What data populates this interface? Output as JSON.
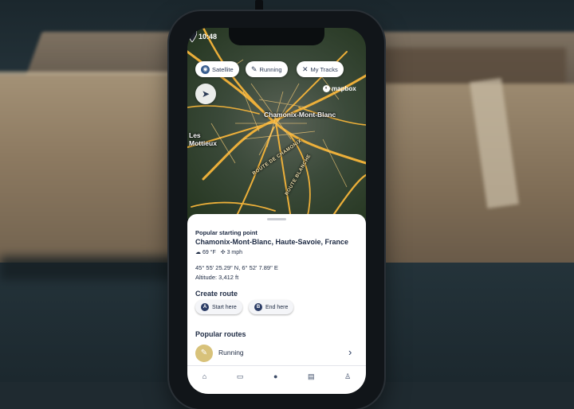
{
  "status": {
    "time": "10:48"
  },
  "map": {
    "chips": [
      {
        "label": "Satellite",
        "icon": "satellite-globe-icon"
      },
      {
        "label": "Running",
        "icon": "running-shoe-icon"
      },
      {
        "label": "My Tracks",
        "icon": "crossed-tracks-icon"
      }
    ],
    "locate_icon": "navigation-arrow-icon",
    "attribution": "mapbox",
    "labels": {
      "town": "Chamonix-Mont-Blanc",
      "village": "Les Mottieux"
    },
    "road_labels": [
      "ROUTE DE CHAMONIX",
      "ROUTE BLANCHE"
    ]
  },
  "sheet": {
    "eyebrow": "Popular starting point",
    "place": "Chamonix-Mont-Blanc, Haute-Savoie, France",
    "weather": {
      "temperature": "69 °F",
      "wind": "3 mph"
    },
    "coordinates": "45° 55' 25.29\" N, 6° 52' 7.89\" E",
    "altitude": "Altitude: 3,412 ft",
    "create_route": {
      "title": "Create route",
      "start": {
        "badge": "A",
        "label": "Start here"
      },
      "end": {
        "badge": "B",
        "label": "End here"
      }
    },
    "popular_routes": {
      "title": "Popular routes",
      "items": [
        {
          "label": "Running",
          "icon": "running-shoe-icon"
        }
      ]
    },
    "tabbar": [
      "home-icon",
      "list-icon",
      "record-icon",
      "car-icon",
      "profile-icon"
    ]
  },
  "colors": {
    "roads": "#f6b53a",
    "sheet_text": "#1c2942",
    "accent": "#2c3d66",
    "route_icon_bg": "#d8c27a"
  }
}
